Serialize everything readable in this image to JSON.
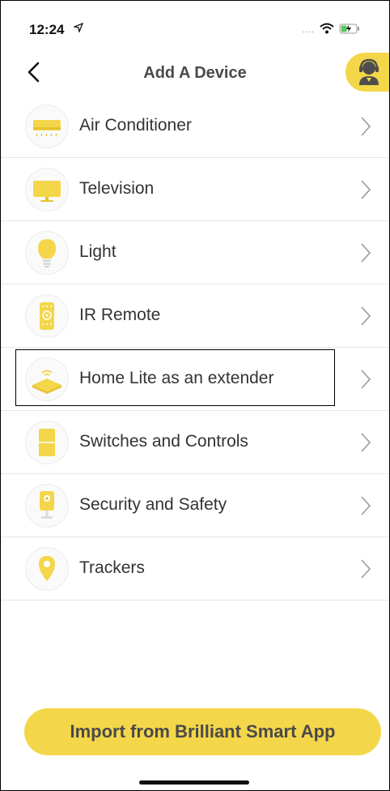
{
  "status_bar": {
    "time": "12:24",
    "signal": "....",
    "location_icon": "location-arrow-icon",
    "wifi_icon": "wifi-icon",
    "battery_icon": "battery-charging-icon"
  },
  "nav": {
    "title": "Add A Device",
    "back_icon": "chevron-left-icon",
    "support_icon": "support-agent-icon"
  },
  "devices": [
    {
      "label": "Air Conditioner",
      "icon": "air-conditioner-icon"
    },
    {
      "label": "Television",
      "icon": "television-icon"
    },
    {
      "label": "Light",
      "icon": "light-bulb-icon"
    },
    {
      "label": "IR Remote",
      "icon": "ir-remote-icon"
    },
    {
      "label": "Home Lite as an extender",
      "icon": "home-lite-icon"
    },
    {
      "label": "Switches and Controls",
      "icon": "switch-icon"
    },
    {
      "label": "Security and Safety",
      "icon": "security-camera-icon"
    },
    {
      "label": "Trackers",
      "icon": "tracker-pin-icon"
    }
  ],
  "import_button": {
    "label": "Import from Brilliant Smart App"
  },
  "colors": {
    "accent": "#f4d64a",
    "text": "#333333"
  }
}
